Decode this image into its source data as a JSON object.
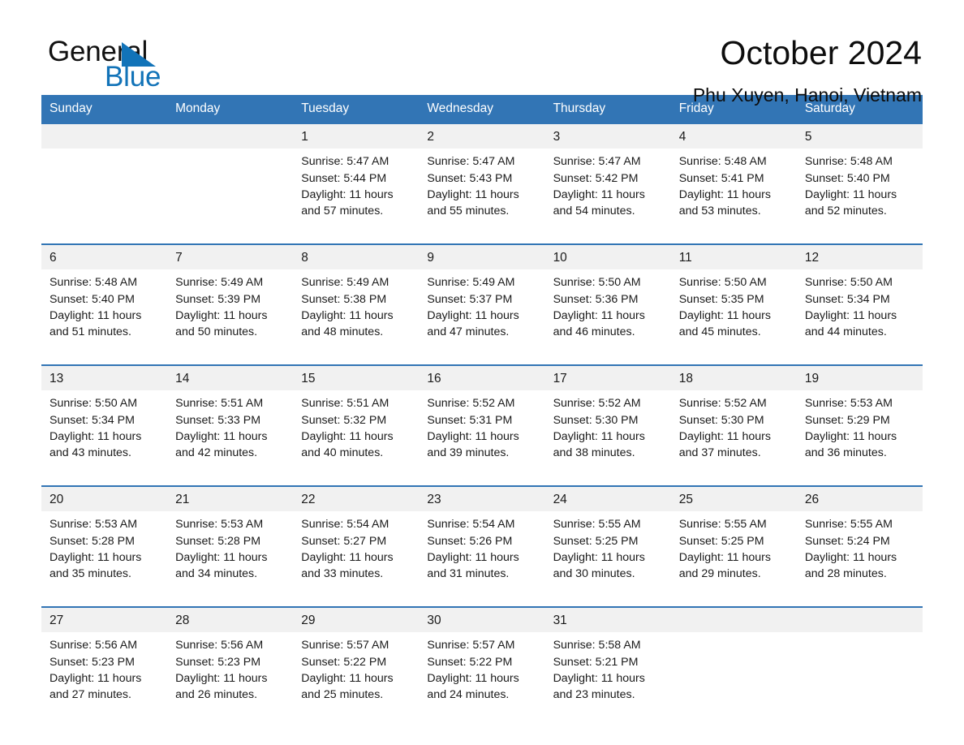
{
  "brand": {
    "word_one": "General",
    "word_two": "Blue",
    "triangle_icon": "triangle-icon",
    "accent_color": "#1273b8"
  },
  "header": {
    "title": "October 2024",
    "location": "Phu Xuyen, Hanoi, Vietnam"
  },
  "theme": {
    "header_blue": "#3275b5",
    "day_band_gray": "#f1f1f1",
    "text_color": "#1a1a1a"
  },
  "weekdays": [
    "Sunday",
    "Monday",
    "Tuesday",
    "Wednesday",
    "Thursday",
    "Friday",
    "Saturday"
  ],
  "weeks": [
    [
      {
        "day": "",
        "sunrise": "",
        "sunset": "",
        "daylight_1": "",
        "daylight_2": ""
      },
      {
        "day": "",
        "sunrise": "",
        "sunset": "",
        "daylight_1": "",
        "daylight_2": ""
      },
      {
        "day": "1",
        "sunrise": "Sunrise: 5:47 AM",
        "sunset": "Sunset: 5:44 PM",
        "daylight_1": "Daylight: 11 hours",
        "daylight_2": "and 57 minutes."
      },
      {
        "day": "2",
        "sunrise": "Sunrise: 5:47 AM",
        "sunset": "Sunset: 5:43 PM",
        "daylight_1": "Daylight: 11 hours",
        "daylight_2": "and 55 minutes."
      },
      {
        "day": "3",
        "sunrise": "Sunrise: 5:47 AM",
        "sunset": "Sunset: 5:42 PM",
        "daylight_1": "Daylight: 11 hours",
        "daylight_2": "and 54 minutes."
      },
      {
        "day": "4",
        "sunrise": "Sunrise: 5:48 AM",
        "sunset": "Sunset: 5:41 PM",
        "daylight_1": "Daylight: 11 hours",
        "daylight_2": "and 53 minutes."
      },
      {
        "day": "5",
        "sunrise": "Sunrise: 5:48 AM",
        "sunset": "Sunset: 5:40 PM",
        "daylight_1": "Daylight: 11 hours",
        "daylight_2": "and 52 minutes."
      }
    ],
    [
      {
        "day": "6",
        "sunrise": "Sunrise: 5:48 AM",
        "sunset": "Sunset: 5:40 PM",
        "daylight_1": "Daylight: 11 hours",
        "daylight_2": "and 51 minutes."
      },
      {
        "day": "7",
        "sunrise": "Sunrise: 5:49 AM",
        "sunset": "Sunset: 5:39 PM",
        "daylight_1": "Daylight: 11 hours",
        "daylight_2": "and 50 minutes."
      },
      {
        "day": "8",
        "sunrise": "Sunrise: 5:49 AM",
        "sunset": "Sunset: 5:38 PM",
        "daylight_1": "Daylight: 11 hours",
        "daylight_2": "and 48 minutes."
      },
      {
        "day": "9",
        "sunrise": "Sunrise: 5:49 AM",
        "sunset": "Sunset: 5:37 PM",
        "daylight_1": "Daylight: 11 hours",
        "daylight_2": "and 47 minutes."
      },
      {
        "day": "10",
        "sunrise": "Sunrise: 5:50 AM",
        "sunset": "Sunset: 5:36 PM",
        "daylight_1": "Daylight: 11 hours",
        "daylight_2": "and 46 minutes."
      },
      {
        "day": "11",
        "sunrise": "Sunrise: 5:50 AM",
        "sunset": "Sunset: 5:35 PM",
        "daylight_1": "Daylight: 11 hours",
        "daylight_2": "and 45 minutes."
      },
      {
        "day": "12",
        "sunrise": "Sunrise: 5:50 AM",
        "sunset": "Sunset: 5:34 PM",
        "daylight_1": "Daylight: 11 hours",
        "daylight_2": "and 44 minutes."
      }
    ],
    [
      {
        "day": "13",
        "sunrise": "Sunrise: 5:50 AM",
        "sunset": "Sunset: 5:34 PM",
        "daylight_1": "Daylight: 11 hours",
        "daylight_2": "and 43 minutes."
      },
      {
        "day": "14",
        "sunrise": "Sunrise: 5:51 AM",
        "sunset": "Sunset: 5:33 PM",
        "daylight_1": "Daylight: 11 hours",
        "daylight_2": "and 42 minutes."
      },
      {
        "day": "15",
        "sunrise": "Sunrise: 5:51 AM",
        "sunset": "Sunset: 5:32 PM",
        "daylight_1": "Daylight: 11 hours",
        "daylight_2": "and 40 minutes."
      },
      {
        "day": "16",
        "sunrise": "Sunrise: 5:52 AM",
        "sunset": "Sunset: 5:31 PM",
        "daylight_1": "Daylight: 11 hours",
        "daylight_2": "and 39 minutes."
      },
      {
        "day": "17",
        "sunrise": "Sunrise: 5:52 AM",
        "sunset": "Sunset: 5:30 PM",
        "daylight_1": "Daylight: 11 hours",
        "daylight_2": "and 38 minutes."
      },
      {
        "day": "18",
        "sunrise": "Sunrise: 5:52 AM",
        "sunset": "Sunset: 5:30 PM",
        "daylight_1": "Daylight: 11 hours",
        "daylight_2": "and 37 minutes."
      },
      {
        "day": "19",
        "sunrise": "Sunrise: 5:53 AM",
        "sunset": "Sunset: 5:29 PM",
        "daylight_1": "Daylight: 11 hours",
        "daylight_2": "and 36 minutes."
      }
    ],
    [
      {
        "day": "20",
        "sunrise": "Sunrise: 5:53 AM",
        "sunset": "Sunset: 5:28 PM",
        "daylight_1": "Daylight: 11 hours",
        "daylight_2": "and 35 minutes."
      },
      {
        "day": "21",
        "sunrise": "Sunrise: 5:53 AM",
        "sunset": "Sunset: 5:28 PM",
        "daylight_1": "Daylight: 11 hours",
        "daylight_2": "and 34 minutes."
      },
      {
        "day": "22",
        "sunrise": "Sunrise: 5:54 AM",
        "sunset": "Sunset: 5:27 PM",
        "daylight_1": "Daylight: 11 hours",
        "daylight_2": "and 33 minutes."
      },
      {
        "day": "23",
        "sunrise": "Sunrise: 5:54 AM",
        "sunset": "Sunset: 5:26 PM",
        "daylight_1": "Daylight: 11 hours",
        "daylight_2": "and 31 minutes."
      },
      {
        "day": "24",
        "sunrise": "Sunrise: 5:55 AM",
        "sunset": "Sunset: 5:25 PM",
        "daylight_1": "Daylight: 11 hours",
        "daylight_2": "and 30 minutes."
      },
      {
        "day": "25",
        "sunrise": "Sunrise: 5:55 AM",
        "sunset": "Sunset: 5:25 PM",
        "daylight_1": "Daylight: 11 hours",
        "daylight_2": "and 29 minutes."
      },
      {
        "day": "26",
        "sunrise": "Sunrise: 5:55 AM",
        "sunset": "Sunset: 5:24 PM",
        "daylight_1": "Daylight: 11 hours",
        "daylight_2": "and 28 minutes."
      }
    ],
    [
      {
        "day": "27",
        "sunrise": "Sunrise: 5:56 AM",
        "sunset": "Sunset: 5:23 PM",
        "daylight_1": "Daylight: 11 hours",
        "daylight_2": "and 27 minutes."
      },
      {
        "day": "28",
        "sunrise": "Sunrise: 5:56 AM",
        "sunset": "Sunset: 5:23 PM",
        "daylight_1": "Daylight: 11 hours",
        "daylight_2": "and 26 minutes."
      },
      {
        "day": "29",
        "sunrise": "Sunrise: 5:57 AM",
        "sunset": "Sunset: 5:22 PM",
        "daylight_1": "Daylight: 11 hours",
        "daylight_2": "and 25 minutes."
      },
      {
        "day": "30",
        "sunrise": "Sunrise: 5:57 AM",
        "sunset": "Sunset: 5:22 PM",
        "daylight_1": "Daylight: 11 hours",
        "daylight_2": "and 24 minutes."
      },
      {
        "day": "31",
        "sunrise": "Sunrise: 5:58 AM",
        "sunset": "Sunset: 5:21 PM",
        "daylight_1": "Daylight: 11 hours",
        "daylight_2": "and 23 minutes."
      },
      {
        "day": "",
        "sunrise": "",
        "sunset": "",
        "daylight_1": "",
        "daylight_2": ""
      },
      {
        "day": "",
        "sunrise": "",
        "sunset": "",
        "daylight_1": "",
        "daylight_2": ""
      }
    ]
  ]
}
